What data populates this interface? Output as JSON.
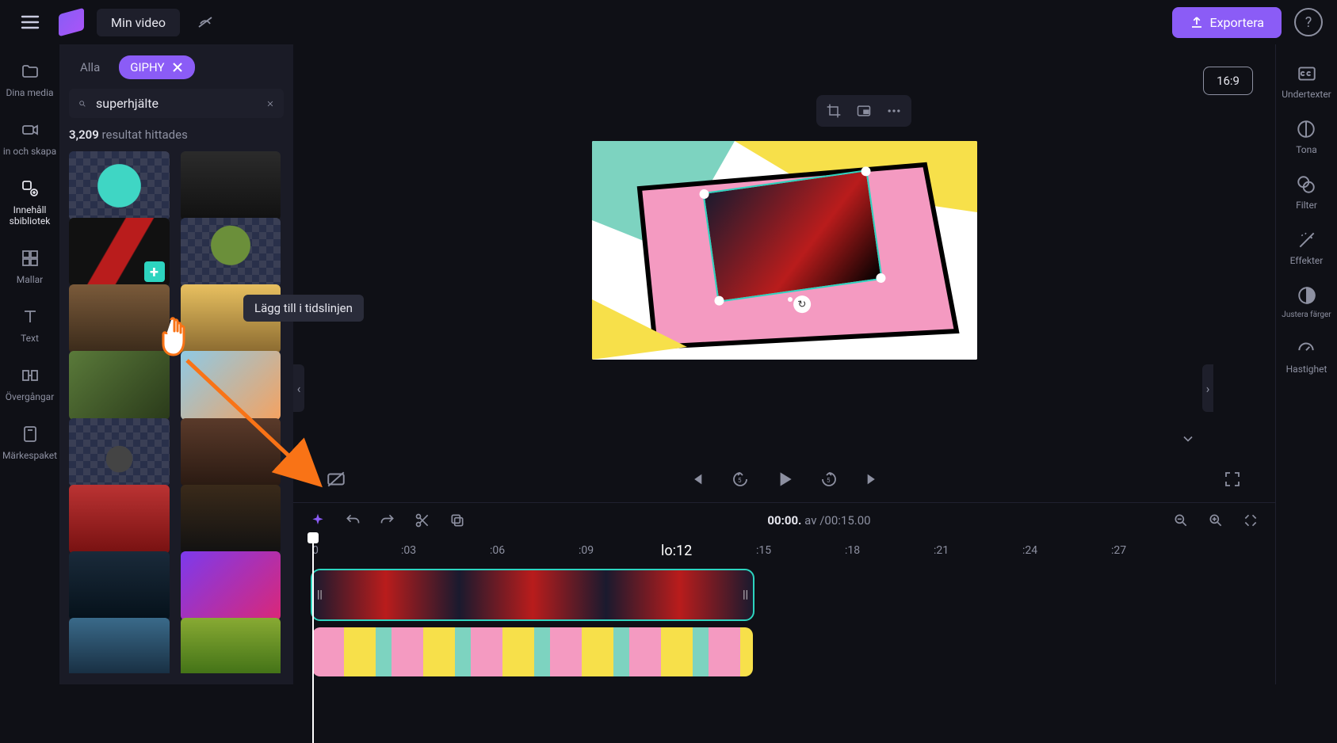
{
  "header": {
    "title": "Min video",
    "export_label": "Exportera"
  },
  "rail": {
    "items": [
      {
        "icon": "folder",
        "label": "Dina media"
      },
      {
        "icon": "camera",
        "label": "in och skapa"
      },
      {
        "icon": "library",
        "label": "Innehåll sbibliotek"
      },
      {
        "icon": "grid",
        "label": "Mallar"
      },
      {
        "icon": "text",
        "label": "Text"
      },
      {
        "icon": "transition",
        "label": "Övergångar"
      },
      {
        "icon": "brand",
        "label": "Märkespaket"
      }
    ]
  },
  "sidebar": {
    "tab_all": "Alla",
    "tab_active": "GIPHY",
    "search_value": "superhjälte",
    "result_count": "3,209",
    "result_label": "resultat hittades",
    "tooltip": "Lägg till i tidslinjen"
  },
  "preview": {
    "aspect": "16:9"
  },
  "timeline": {
    "current": "00:00.",
    "sep": "av",
    "total": "/00:15.00",
    "center_label": "lo:12",
    "marks": [
      "0",
      ":03",
      ":06",
      ":09",
      ":15",
      ":18",
      ":21",
      ":24",
      ":27"
    ]
  },
  "right_rail": {
    "items": [
      {
        "icon": "cc",
        "label": "Undertexter"
      },
      {
        "icon": "fade",
        "label": "Tona"
      },
      {
        "icon": "filter",
        "label": "Filter"
      },
      {
        "icon": "fx",
        "label": "Effekter"
      },
      {
        "icon": "adjust",
        "label": "Justera färger"
      },
      {
        "icon": "speed",
        "label": "Hastighet"
      }
    ]
  }
}
